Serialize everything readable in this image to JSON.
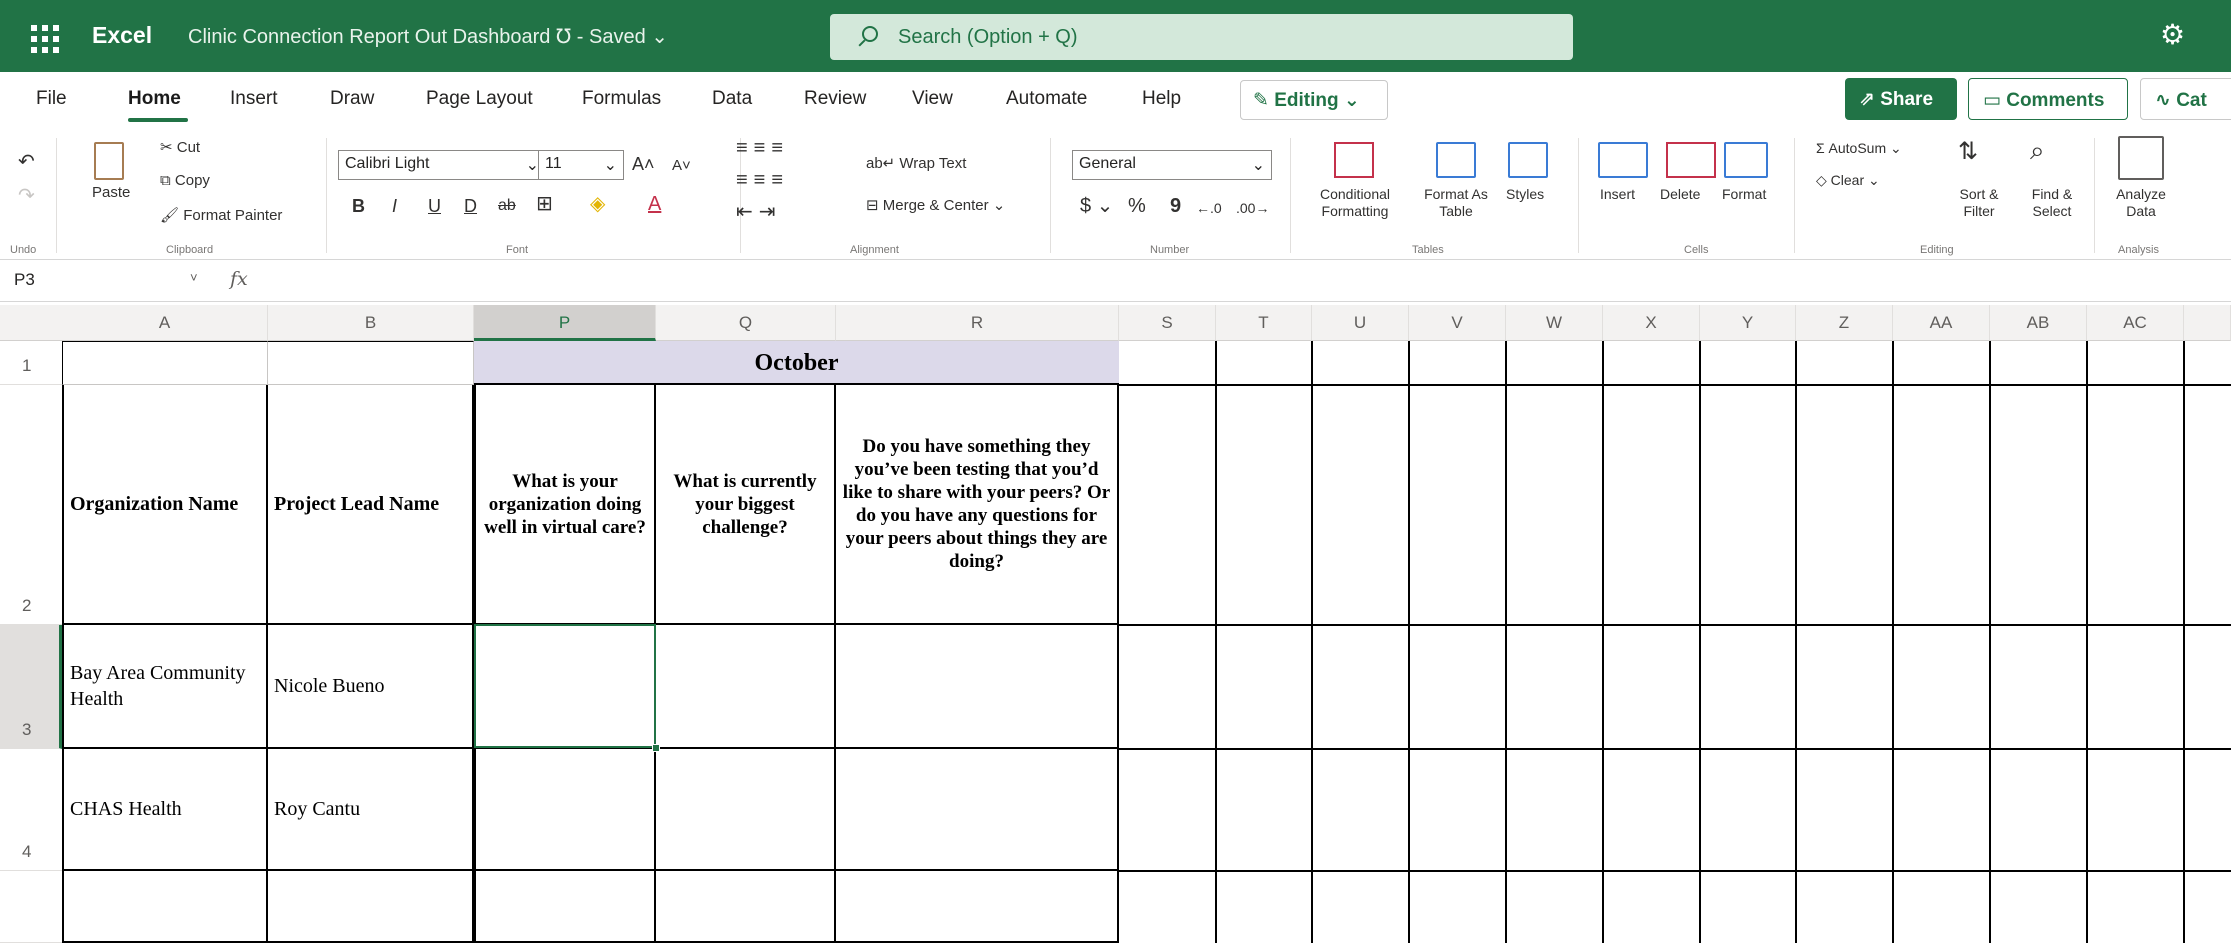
{
  "titlebar": {
    "app_name": "Excel",
    "doc_title": "Clinic Connection Report Out Dashboard ℧ - Saved  ⌄",
    "search_placeholder": "Search (Option + Q)",
    "colors": {
      "accent": "#217346"
    }
  },
  "menu": {
    "tabs": [
      "File",
      "Home",
      "Insert",
      "Draw",
      "Page Layout",
      "Formulas",
      "Data",
      "Review",
      "View",
      "Automate",
      "Help"
    ],
    "active_tab": "Home",
    "editing_label": "Editing",
    "share_label": "Share",
    "comments_label": "Comments",
    "catchup_label": "Cat"
  },
  "ribbon": {
    "undo": {
      "group": "Undo"
    },
    "clipboard": {
      "group": "Clipboard",
      "paste": "Paste",
      "cut": "Cut",
      "copy": "Copy",
      "format_painter": "Format Painter"
    },
    "font": {
      "group": "Font",
      "name": "Calibri Light",
      "size": "11",
      "bold": "B",
      "italic": "I",
      "underline": "U",
      "double_underline": "D",
      "strike": "ab"
    },
    "alignment": {
      "group": "Alignment",
      "wrap": "Wrap Text",
      "merge": "Merge & Center"
    },
    "number": {
      "group": "Number",
      "format": "General",
      "currency": "$",
      "percent": "%",
      "comma": "9"
    },
    "tables": {
      "group": "Tables",
      "conditional": "Conditional Formatting",
      "format_as_table": "Format As Table",
      "styles": "Styles"
    },
    "cells": {
      "group": "Cells",
      "insert": "Insert",
      "delete": "Delete",
      "format": "Format"
    },
    "editing": {
      "group": "Editing",
      "autosum": "AutoSum",
      "clear": "Clear",
      "sort": "Sort & Filter",
      "find": "Find & Select"
    },
    "analysis": {
      "group": "Analysis",
      "analyze": "Analyze Data"
    }
  },
  "formula_bar": {
    "cell_ref": "P3",
    "fx": "fx",
    "value": ""
  },
  "grid": {
    "columns": [
      "A",
      "B",
      "P",
      "Q",
      "R",
      "S",
      "T",
      "U",
      "V",
      "W",
      "X",
      "Y",
      "Z",
      "AA",
      "AB",
      "AC"
    ],
    "selected_column": "P",
    "rows": [
      "1",
      "2",
      "3",
      "4"
    ],
    "selected_row": "3",
    "month_header": "October",
    "headers": {
      "org": "Organization Name",
      "lead": "Project Lead Name",
      "well": "What is your organization doing well in virtual care?",
      "challenge": "What is currently your biggest challenge?",
      "share": "Do you have something they you’ve been testing that you’d like to share with your peers? Or do you have any questions for your peers about things they are doing?"
    },
    "data_rows": [
      {
        "org": "Bay Area Community Health",
        "lead": "Nicole Bueno"
      },
      {
        "org": "CHAS Health",
        "lead": "Roy Cantu"
      }
    ]
  }
}
